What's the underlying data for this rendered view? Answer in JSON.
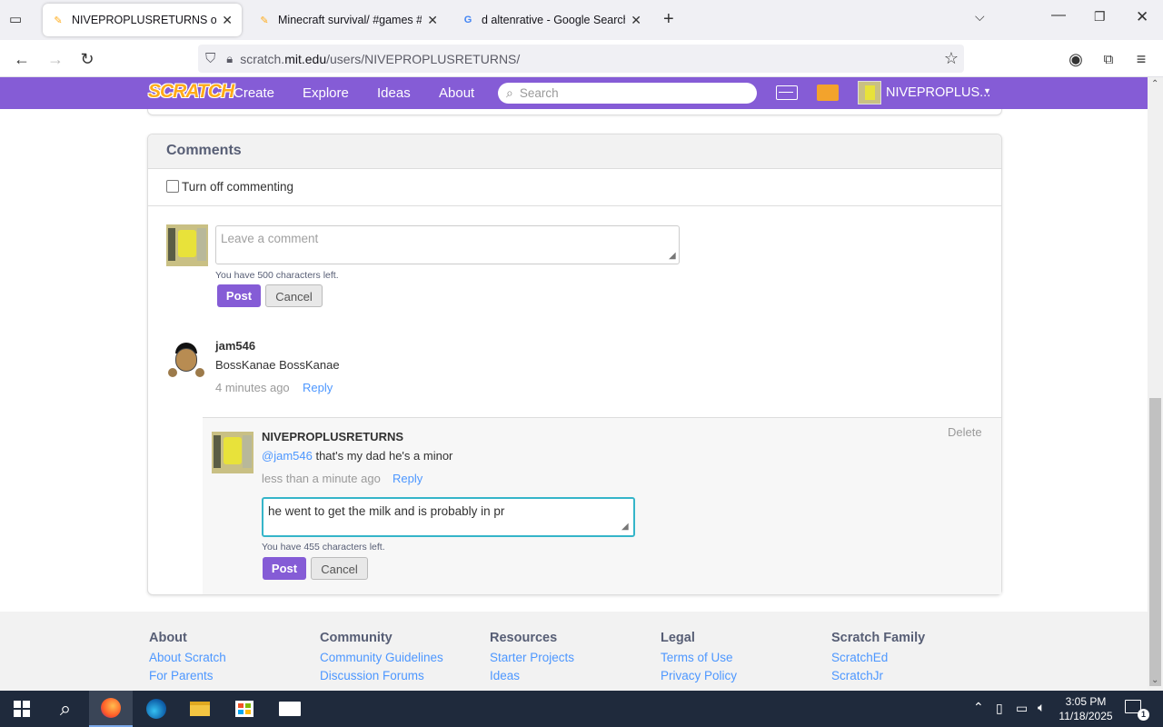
{
  "browser": {
    "tabs": [
      {
        "title": "NIVEPROPLUSRETURNS on Scra",
        "active": true
      },
      {
        "title": "Minecraft survival/ #games #tre",
        "active": false
      },
      {
        "title": "d altenrative - Google Search",
        "active": false
      }
    ],
    "url_prefix": "scratch.",
    "url_domain": "mit.edu",
    "url_path": "/users/NIVEPROPLUSRETURNS/"
  },
  "scratch_nav": {
    "logo": "SCRATCH",
    "links": [
      "Create",
      "Explore",
      "Ideas",
      "About"
    ],
    "search_placeholder": "Search",
    "username": "NIVEPROPLUS..."
  },
  "comments": {
    "heading": "Comments",
    "turn_off_label": "Turn off commenting",
    "new_comment_placeholder": "Leave a comment",
    "chars_left": "You have 500 characters left.",
    "post": "Post",
    "cancel": "Cancel",
    "thread": {
      "author": "jam546",
      "text": "BossKanae BossKanae",
      "time": "4 minutes ago",
      "reply": "Reply"
    },
    "reply": {
      "author": "NIVEPROPLUSRETURNS",
      "mention": "@jam546",
      "text": " that's my dad he's a minor",
      "time": "less than a minute ago",
      "reply": "Reply",
      "delete": "Delete",
      "draft": "he went to get the milk and is probably in pr",
      "chars_left": "You have 455 characters left.",
      "post": "Post",
      "cancel": "Cancel"
    }
  },
  "footer": {
    "columns": [
      {
        "title": "About",
        "links": [
          "About Scratch",
          "For Parents"
        ]
      },
      {
        "title": "Community",
        "links": [
          "Community Guidelines",
          "Discussion Forums"
        ]
      },
      {
        "title": "Resources",
        "links": [
          "Starter Projects",
          "Ideas"
        ]
      },
      {
        "title": "Legal",
        "links": [
          "Terms of Use",
          "Privacy Policy"
        ]
      },
      {
        "title": "Scratch Family",
        "links": [
          "ScratchEd",
          "ScratchJr"
        ]
      }
    ]
  },
  "taskbar": {
    "time": "3:05 PM",
    "date": "11/18/2025",
    "notification_count": "1"
  },
  "colors": {
    "scratch_purple": "#855cd6",
    "link_blue": "#4d97ff",
    "focus_teal": "#35b5c9"
  }
}
